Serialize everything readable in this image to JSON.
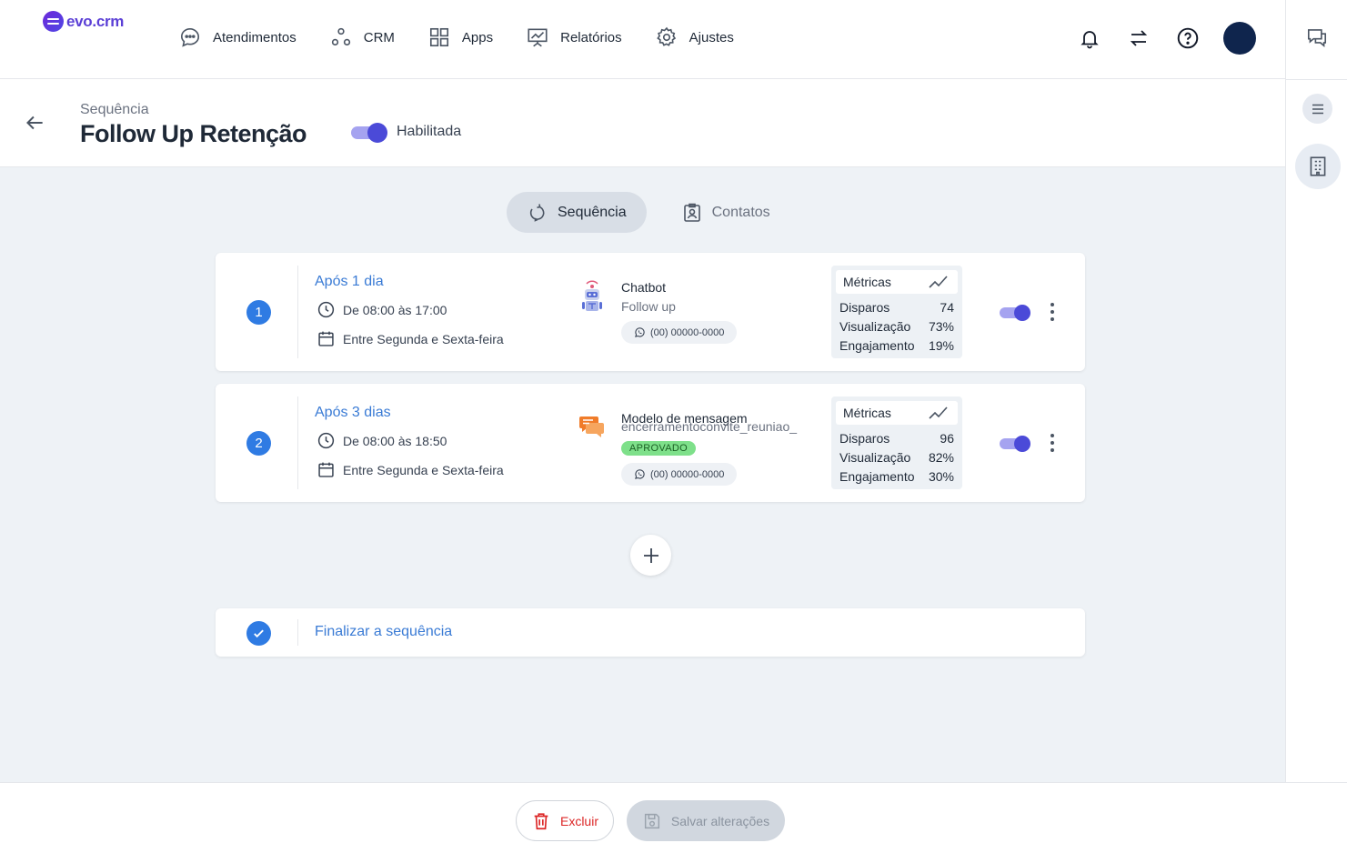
{
  "app": {
    "logo_text": "evo.crm",
    "brand_color": "#5b3fd6",
    "accent_color": "#2f7be3"
  },
  "nav": {
    "items": [
      {
        "label": "Atendimentos",
        "icon": "chat-bubble-icon"
      },
      {
        "label": "CRM",
        "icon": "nodes-icon"
      },
      {
        "label": "Apps",
        "icon": "grid-icon"
      },
      {
        "label": "Relatórios",
        "icon": "presentation-chart-icon"
      },
      {
        "label": "Ajustes",
        "icon": "gear-icon"
      }
    ]
  },
  "header": {
    "breadcrumb": "Sequência",
    "title": "Follow Up Retenção",
    "toggle_label": "Habilitada",
    "enabled": true
  },
  "tabs": [
    {
      "label": "Sequência",
      "active": true
    },
    {
      "label": "Contatos",
      "active": false
    }
  ],
  "steps": [
    {
      "number": "1",
      "delay": "Após 1 dia",
      "time_window": "De 08:00 às 17:00",
      "days": "Entre Segunda e Sexta-feira",
      "action_type": "Chatbot",
      "action_name": "Follow up",
      "phone": "(00) 00000-0000",
      "enabled": true,
      "metrics": {
        "title": "Métricas",
        "rows": [
          {
            "label": "Disparos",
            "value": "74"
          },
          {
            "label": "Visualização",
            "value": "73%"
          },
          {
            "label": "Engajamento",
            "value": "19%"
          }
        ]
      }
    },
    {
      "number": "2",
      "delay": "Após 3 dias",
      "time_window": "De 08:00 às 18:50",
      "days": "Entre Segunda e Sexta-feira",
      "action_type": "Modelo de mensagem",
      "action_name": "encerramentoconvite_reuniao_",
      "status_badge": "APROVADO",
      "phone": "(00) 00000-0000",
      "enabled": true,
      "metrics": {
        "title": "Métricas",
        "rows": [
          {
            "label": "Disparos",
            "value": "96"
          },
          {
            "label": "Visualização",
            "value": "82%"
          },
          {
            "label": "Engajamento",
            "value": "30%"
          }
        ]
      }
    }
  ],
  "finish": {
    "label": "Finalizar a sequência"
  },
  "footer": {
    "delete_label": "Excluir",
    "save_label": "Salvar alterações"
  }
}
